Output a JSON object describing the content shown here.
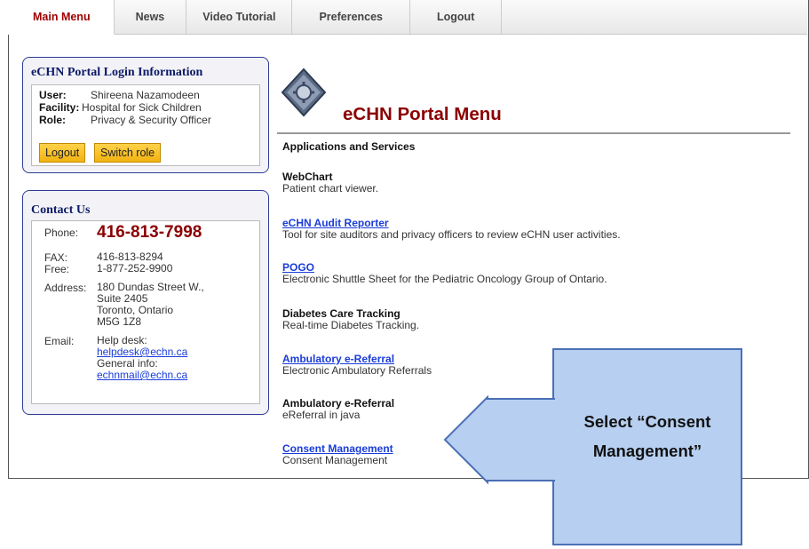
{
  "nav": {
    "tabs": [
      "Main Menu",
      "News",
      "Video Tutorial",
      "Preferences",
      "Logout"
    ],
    "active_index": 0
  },
  "login": {
    "title": "eCHN Portal Login Information",
    "user_label": "User:",
    "user_value": "Shireena Nazamodeen",
    "facility_label": "Facility:",
    "facility_value": "Hospital for Sick Children",
    "role_label": "Role:",
    "role_value": "Privacy & Security Officer",
    "logout_button": "Logout",
    "switch_role_button": "Switch role"
  },
  "contact": {
    "title": "Contact Us",
    "phone_label": "Phone:",
    "phone_value": "416-813-7998",
    "fax_label": "FAX:",
    "fax_value": "416-813-8294",
    "free_label": "Free:",
    "free_value": "1-877-252-9900",
    "address_label": "Address:",
    "address_lines": [
      "180 Dundas Street W.,",
      "Suite 2405",
      "Toronto, Ontario",
      "M5G 1Z8"
    ],
    "email_label": "Email:",
    "helpdesk_label": "Help desk:",
    "helpdesk_email": "helpdesk@echn.ca",
    "general_label": "General info:",
    "general_email": "echnmail@echn.ca"
  },
  "main": {
    "title": "eCHN Portal Menu",
    "section_heading": "Applications and Services",
    "apps": [
      {
        "name": "WebChart",
        "desc": "Patient chart viewer.",
        "link": false
      },
      {
        "name": "eCHN Audit Reporter",
        "desc": "Tool for site auditors and privacy officers to review eCHN user activities.",
        "link": true
      },
      {
        "name": "POGO",
        "desc": "Electronic Shuttle Sheet for the Pediatric Oncology Group of Ontario.",
        "link": true
      },
      {
        "name": "Diabetes Care Tracking",
        "desc": "Real-time Diabetes Tracking.",
        "link": false
      },
      {
        "name": "Ambulatory e-Referral",
        "desc": "Electronic Ambulatory Referrals",
        "link": true
      },
      {
        "name": "Ambulatory e-Referral",
        "desc": "eReferral in java",
        "link": false
      },
      {
        "name": "Consent Management",
        "desc": "Consent Management",
        "link": true
      }
    ]
  },
  "callout": {
    "line1": "Select “Consent",
    "line2": "Management”",
    "fill_color": "#b7cff0",
    "border_color": "#4a6fb5"
  },
  "colors": {
    "accent": "#8b0000",
    "box_border": "#2d3b96",
    "link": "#1a3cd8",
    "button": "#f2b211"
  }
}
